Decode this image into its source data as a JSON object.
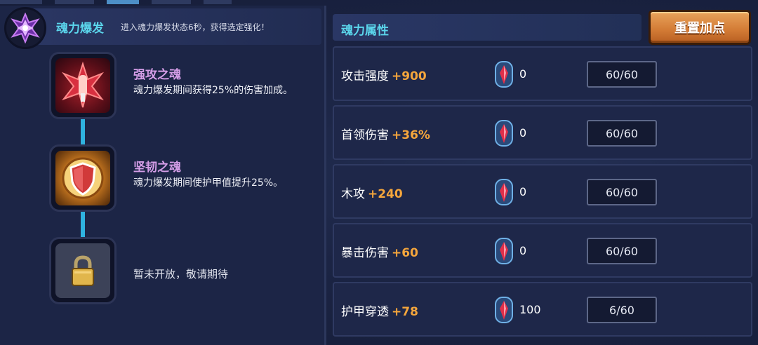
{
  "burst": {
    "title": "魂力爆发",
    "description": "进入魂力爆发状态6秒，获得选定强化！"
  },
  "skills": [
    {
      "name": "强攻之魂",
      "description": "魂力爆发期间获得25%的伤害加成。",
      "icon": "red-soul-icon"
    },
    {
      "name": "坚韧之魂",
      "description": "魂力爆发期间使护甲值提升25%。",
      "icon": "shield-soul-icon"
    },
    {
      "name": "",
      "description": "暂未开放，敬请期待",
      "icon": "lock-icon"
    }
  ],
  "attributes": {
    "title": "魂力属性",
    "reset_label": "重置加点",
    "rows": [
      {
        "label": "攻击强度",
        "bonus": "+900",
        "crystals": "0",
        "level": "60/60"
      },
      {
        "label": "首领伤害",
        "bonus": "+36%",
        "crystals": "0",
        "level": "60/60"
      },
      {
        "label": "木攻",
        "bonus": "+240",
        "crystals": "0",
        "level": "60/60"
      },
      {
        "label": "暴击伤害",
        "bonus": "+60",
        "crystals": "0",
        "level": "60/60"
      },
      {
        "label": "护甲穿透",
        "bonus": "+78",
        "crystals": "100",
        "level": "6/60"
      }
    ]
  },
  "colors": {
    "accent_cyan": "#5bd6ec",
    "bonus_orange": "#f5a63c",
    "skill_name_purple": "#d59ee8",
    "button_orange": "#d27a34"
  }
}
